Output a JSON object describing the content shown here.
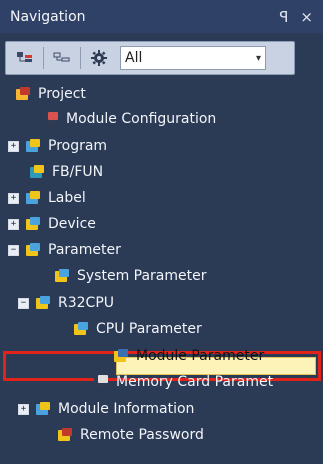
{
  "window": {
    "title": "Navigation",
    "pin_glyph": "ꟼ",
    "close_glyph": "×"
  },
  "toolbar": {
    "filter_value": "All",
    "filter_arrow": "▾"
  },
  "tree": [
    {
      "label": "Project",
      "icon": "project-icon"
    },
    {
      "label": "Module Configuration",
      "icon": "module-configuration-icon"
    },
    {
      "label": "Program",
      "icon": "program-icon",
      "expander": "+"
    },
    {
      "label": "FB/FUN",
      "icon": "fb-fun-icon"
    },
    {
      "label": "Label",
      "icon": "label-icon",
      "expander": "+"
    },
    {
      "label": "Device",
      "icon": "device-icon",
      "expander": "+"
    },
    {
      "label": "Parameter",
      "icon": "parameter-icon",
      "expander": "−"
    },
    {
      "label": "System Parameter",
      "icon": "system-parameter-icon"
    },
    {
      "label": "R32CPU",
      "icon": "r32cpu-icon",
      "expander": "−"
    },
    {
      "label": "CPU Parameter",
      "icon": "cpu-parameter-icon"
    },
    {
      "label": "Module Parameter",
      "icon": "module-parameter-icon",
      "selected": true
    },
    {
      "label": "Memory Card Paramet",
      "icon": "memory-card-icon"
    },
    {
      "label": "Module Information",
      "icon": "module-information-icon",
      "expander": "+"
    },
    {
      "label": "Remote Password",
      "icon": "remote-password-icon"
    }
  ],
  "colors": {
    "background": "#2b3a55",
    "titlebar": "#2f4166",
    "selection_fill": "#fdf3b8",
    "highlight_border": "#e2231a"
  }
}
